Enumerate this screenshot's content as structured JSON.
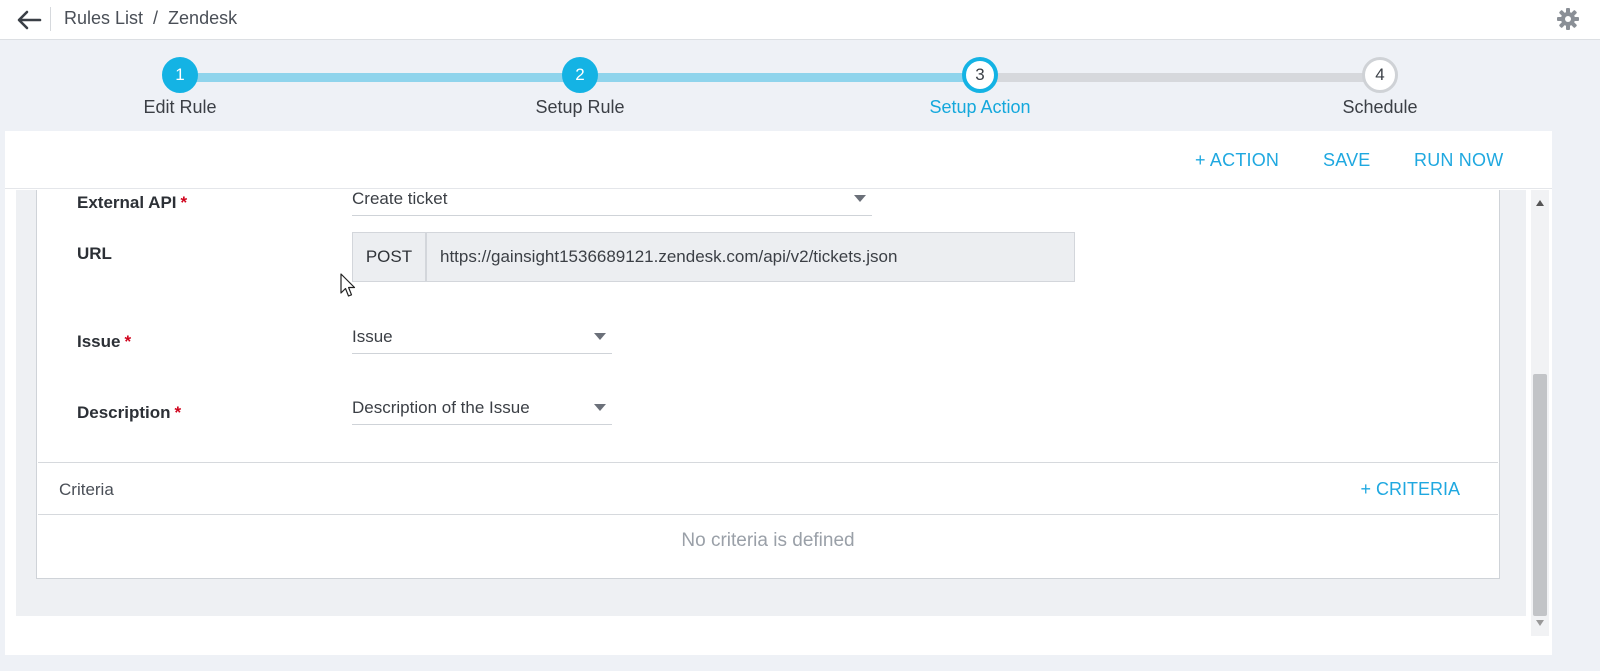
{
  "header": {
    "back_icon": "arrow-left-icon",
    "breadcrumb": [
      "Rules List",
      "/",
      "Zendesk"
    ],
    "settings_icon": "gear-icon"
  },
  "stepper": {
    "steps": [
      {
        "number": "1",
        "label": "Edit Rule",
        "state": "done"
      },
      {
        "number": "2",
        "label": "Setup Rule",
        "state": "done"
      },
      {
        "number": "3",
        "label": "Setup Action",
        "state": "active"
      },
      {
        "number": "4",
        "label": "Schedule",
        "state": "todo"
      }
    ],
    "colors": {
      "accent": "#14b3e4",
      "done_track": "#8fd4ec",
      "todo_track": "#d6d8dc"
    }
  },
  "toolbar": {
    "add_action": "+ ACTION",
    "save": "SAVE",
    "run_now": "RUN NOW"
  },
  "form": {
    "external_api": {
      "label": "External API",
      "required": "*",
      "value": "Create ticket"
    },
    "url": {
      "label": "URL",
      "method": "POST",
      "value": "https://gainsight1536689121.zendesk.com/api/v2/tickets.json"
    },
    "issue": {
      "label": "Issue",
      "required": "*",
      "value": "Issue"
    },
    "description": {
      "label": "Description",
      "required": "*",
      "value": "Description of the Issue"
    }
  },
  "criteria": {
    "title": "Criteria",
    "add": "+ CRITERIA",
    "empty_message": "No criteria is defined"
  }
}
